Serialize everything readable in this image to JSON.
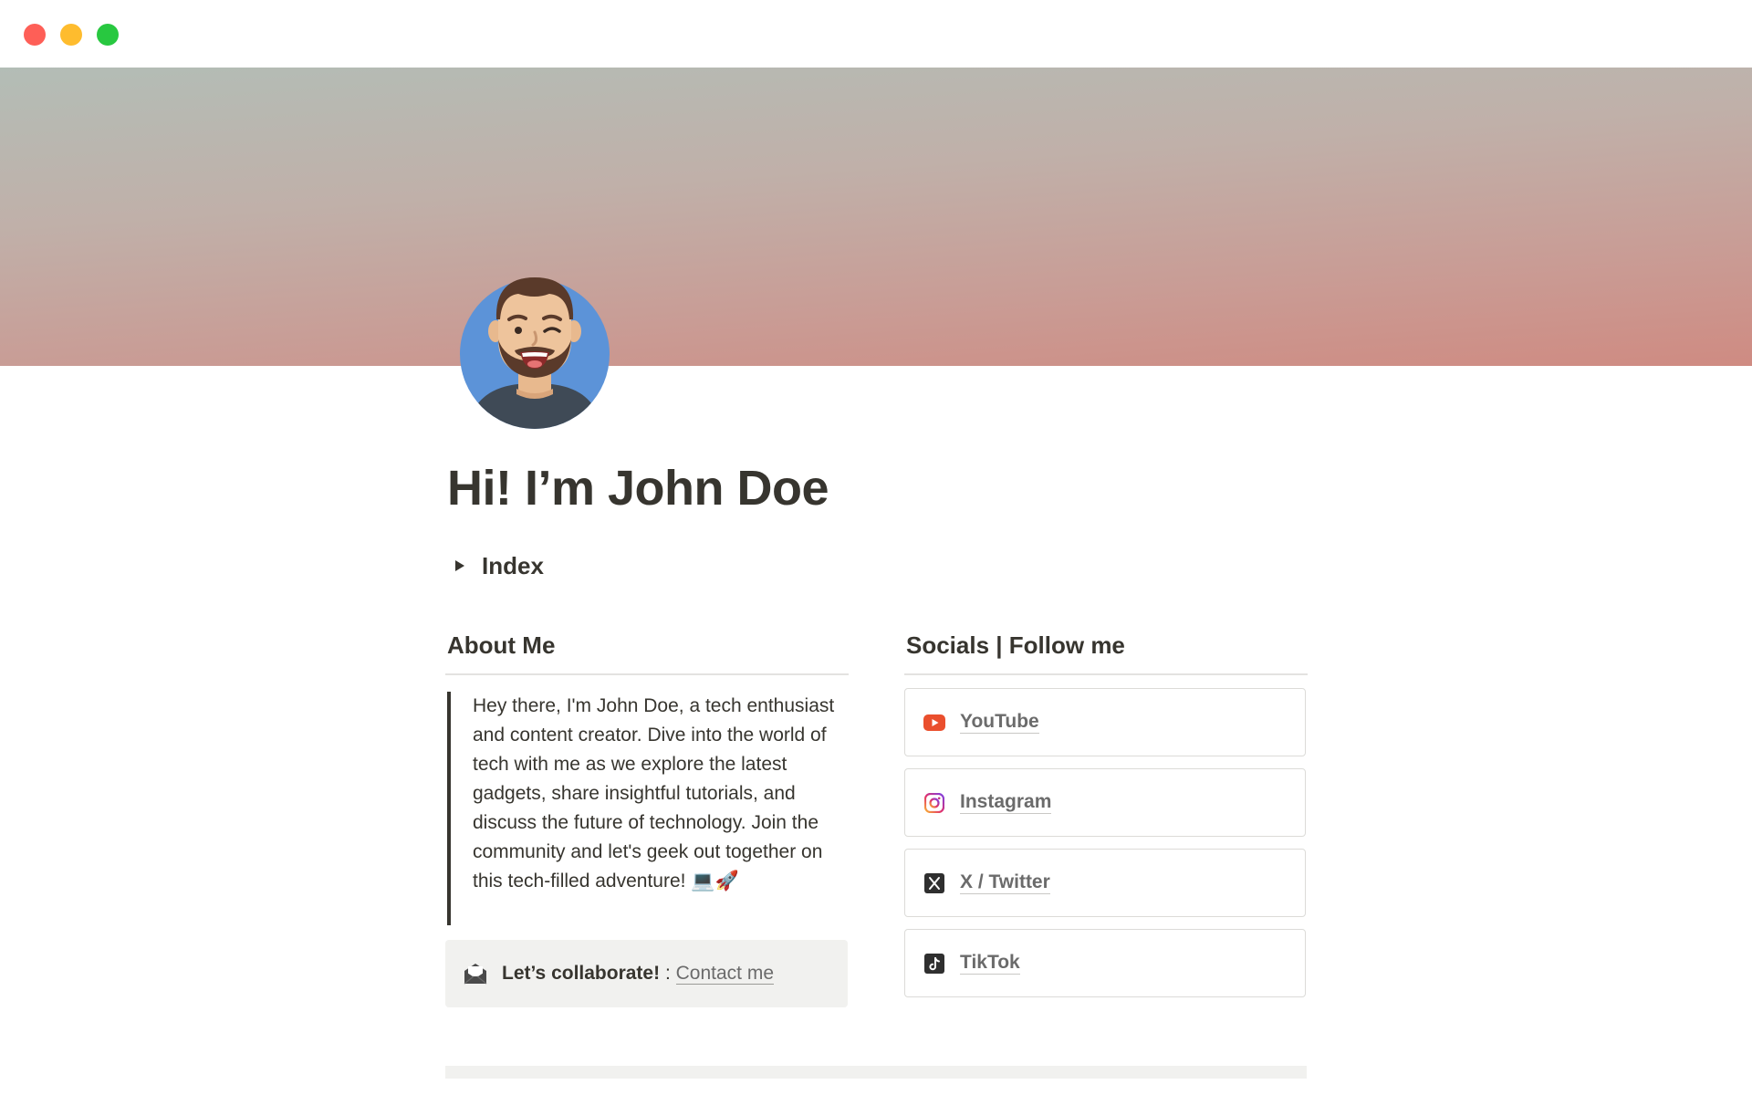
{
  "window": {
    "controls": [
      "close",
      "minimize",
      "maximize"
    ]
  },
  "page": {
    "title": "Hi! I’m John Doe",
    "avatar_icon": "winking-bearded-man-avatar"
  },
  "toggle": {
    "label": "Index",
    "expanded": false
  },
  "about": {
    "heading": "About Me",
    "quote": "Hey there, I'm John Doe, a tech enthusiast and content creator. Dive into the world of tech with me as we explore the latest gadgets, share insightful tutorials, and discuss the future of technology. Join the community and let's geek out together on this tech-filled adventure! 💻🚀",
    "callout": {
      "icon": "open-envelope-icon",
      "bold_text": "Let’s collaborate!",
      "separator": " : ",
      "link_text": "Contact me"
    }
  },
  "socials": {
    "heading": "Socials | Follow me",
    "items": [
      {
        "label": "YouTube",
        "icon": "youtube-icon",
        "color": "#ea4f2d"
      },
      {
        "label": "Instagram",
        "icon": "instagram-icon",
        "color": "#d6249f"
      },
      {
        "label": "X / Twitter",
        "icon": "x-twitter-icon",
        "color": "#2f2f2f"
      },
      {
        "label": "TikTok",
        "icon": "tiktok-icon",
        "color": "#2f2f2f"
      }
    ]
  },
  "colors": {
    "text": "#37352f",
    "muted_link": "#6b6b6b",
    "callout_bg": "#f1f1ef",
    "cover_top": "#b3bdb6",
    "cover_bottom": "#cf8b82"
  }
}
